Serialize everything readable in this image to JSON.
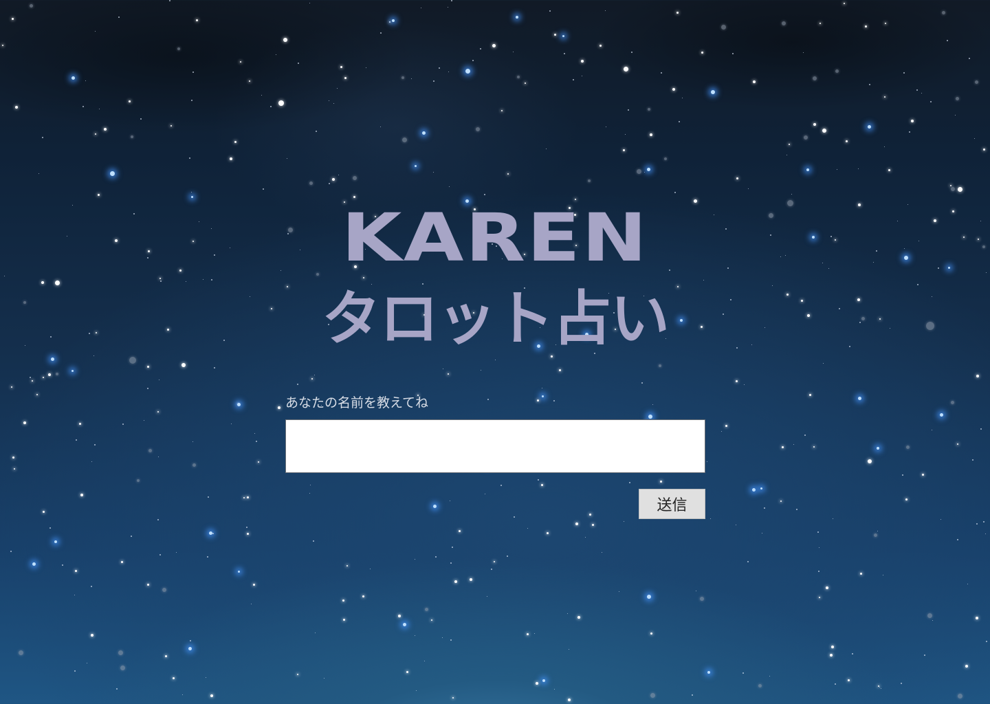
{
  "page": {
    "title_line1": "KAREN",
    "title_line2": "タロット占い"
  },
  "form": {
    "name_label": "あなたの名前を教えてね",
    "name_value": "",
    "name_placeholder": "",
    "submit_label": "送信"
  },
  "colors": {
    "title": "#a7a5c6",
    "label": "#d8dde6",
    "button_bg": "#e0e0e0",
    "sky_top": "#111a26",
    "sky_bottom": "#1f5684"
  }
}
